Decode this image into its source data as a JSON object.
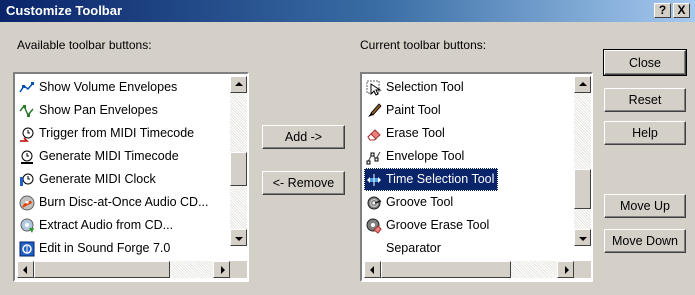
{
  "window": {
    "title": "Customize Toolbar",
    "help_label": "?",
    "close_label": "X"
  },
  "available": {
    "label": "Available toolbar buttons:",
    "items": [
      {
        "label": "Show Volume Envelopes",
        "icon": "volume-envelope-icon"
      },
      {
        "label": "Show Pan Envelopes",
        "icon": "pan-envelope-icon"
      },
      {
        "label": "Trigger from MIDI Timecode",
        "icon": "midi-trigger-icon"
      },
      {
        "label": "Generate MIDI Timecode",
        "icon": "midi-timecode-icon"
      },
      {
        "label": "Generate MIDI Clock",
        "icon": "midi-clock-icon"
      },
      {
        "label": "Burn Disc-at-Once Audio CD...",
        "icon": "burn-cd-icon"
      },
      {
        "label": "Extract Audio from CD...",
        "icon": "extract-cd-icon"
      },
      {
        "label": "Edit in Sound Forge 7.0",
        "icon": "sound-forge-icon"
      }
    ]
  },
  "current": {
    "label": "Current toolbar buttons:",
    "items": [
      {
        "label": "Selection Tool",
        "icon": "selection-tool-icon"
      },
      {
        "label": "Paint Tool",
        "icon": "paint-tool-icon"
      },
      {
        "label": "Erase Tool",
        "icon": "erase-tool-icon"
      },
      {
        "label": "Envelope Tool",
        "icon": "envelope-tool-icon"
      },
      {
        "label": "Time Selection Tool",
        "icon": "time-selection-tool-icon",
        "selected": true
      },
      {
        "label": "Groove Tool",
        "icon": "groove-tool-icon"
      },
      {
        "label": "Groove Erase Tool",
        "icon": "groove-erase-tool-icon"
      },
      {
        "label": "Separator",
        "icon": ""
      }
    ]
  },
  "buttons": {
    "add": "Add ->",
    "remove": "<- Remove",
    "close": "Close",
    "reset": "Reset",
    "help": "Help",
    "move_up": "Move Up",
    "move_down": "Move Down"
  },
  "colors": {
    "selection": "#0a246a",
    "face": "#d4d0c8"
  }
}
